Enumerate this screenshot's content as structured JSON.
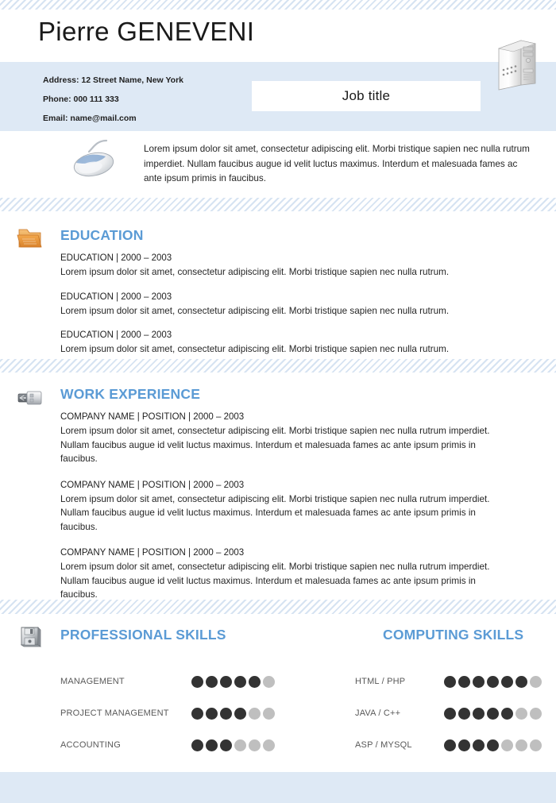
{
  "document": {
    "type": "resume-template",
    "accent_blue": "#5B9BD5",
    "band_blue": "#DEE9F5",
    "stripe_blue": "#D6E3F2",
    "dot_on": "#333333",
    "dot_off": "#BFBFBF"
  },
  "header": {
    "first_name": "Pierre ",
    "last_name": "GENEVENI",
    "job_title": "Job title",
    "contact": {
      "address": "Address: 12 Street  Name, New York",
      "phone": "Phone: 000 111 333",
      "email": "Email: name@mail.com"
    },
    "icon": "computer-tower-icon"
  },
  "profile": {
    "icon": "computer-mouse-icon",
    "text": "Lorem ipsum dolor sit amet, consectetur adipiscing elit. Morbi tristique sapien nec nulla rutrum imperdiet. Nullam faucibus augue id velit luctus maximus. Interdum et malesuada fames ac ante ipsum primis in faucibus."
  },
  "education": {
    "title": "EDUCATION",
    "icon": "folder-icon",
    "entries": [
      {
        "heading": "EDUCATION |  2000  – 2003",
        "body": "Lorem ipsum dolor sit amet, consectetur adipiscing elit. Morbi tristique sapien nec nulla rutrum."
      },
      {
        "heading": "EDUCATION |  2000  – 2003",
        "body": "Lorem ipsum dolor sit amet, consectetur adipiscing elit. Morbi tristique sapien nec nulla rutrum."
      },
      {
        "heading": "EDUCATION |  2000  – 2003",
        "body": "Lorem ipsum dolor sit amet, consectetur adipiscing elit. Morbi tristique sapien nec nulla rutrum."
      }
    ]
  },
  "work_experience": {
    "title": "WORK EXPERIENCE",
    "icon": "usb-drive-icon",
    "entries": [
      {
        "heading": "COMPANY NAME |  POSITION | 2000  – 2003",
        "body": "Lorem ipsum dolor sit amet, consectetur adipiscing elit. Morbi tristique sapien nec nulla rutrum imperdiet. Nullam faucibus augue id velit luctus maximus. Interdum et malesuada fames ac ante ipsum primis in faucibus."
      },
      {
        "heading": "COMPANY NAME |  POSITION | 2000  – 2003",
        "body": "Lorem ipsum dolor sit amet, consectetur adipiscing elit. Morbi tristique sapien nec nulla rutrum imperdiet. Nullam faucibus augue id velit luctus maximus. Interdum et malesuada fames ac ante ipsum primis in faucibus."
      },
      {
        "heading": "COMPANY NAME |  POSITION | 2000  – 2003",
        "body": "Lorem ipsum dolor sit amet, consectetur adipiscing elit. Morbi tristique sapien nec nulla rutrum imperdiet. Nullam faucibus augue id velit luctus maximus. Interdum et malesuada fames ac ante ipsum primis in faucibus."
      }
    ]
  },
  "professional_skills": {
    "title": "PROFESSIONAL SKILLS",
    "icon": "floppy-disk-icon",
    "total_dots": 6,
    "items": [
      {
        "label": "MANAGEMENT",
        "filled": 5
      },
      {
        "label": "PROJECT MANAGEMENT",
        "filled": 4
      },
      {
        "label": "ACCOUNTING",
        "filled": 3
      }
    ]
  },
  "computing_skills": {
    "title": "COMPUTING SKILLS",
    "total_dots": 7,
    "items": [
      {
        "label": "HTML / PHP",
        "filled": 6
      },
      {
        "label": "JAVA / C++",
        "filled": 5
      },
      {
        "label": "ASP / MYSQL",
        "filled": 4
      }
    ]
  }
}
